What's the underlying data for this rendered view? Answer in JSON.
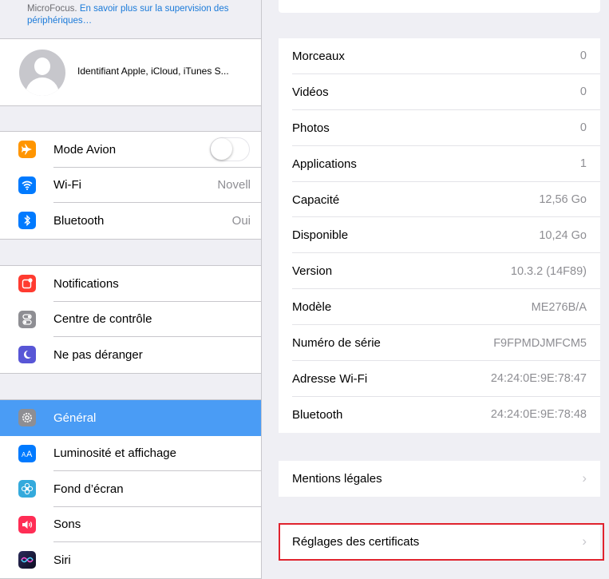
{
  "sidebar": {
    "supervision": {
      "org": "MicroFocus.",
      "link": "En savoir plus sur la supervision des périphériques…"
    },
    "profile": {
      "label": "Identifiant Apple, iCloud, iTunes S..."
    },
    "groups": [
      {
        "items": [
          {
            "label": "Mode Avion",
            "icon": "airplane-icon",
            "color": "#ff9500",
            "value": "",
            "toggle": true,
            "toggle_on": false
          },
          {
            "label": "Wi-Fi",
            "icon": "wifi-icon",
            "color": "#007aff",
            "value": "Novell"
          },
          {
            "label": "Bluetooth",
            "icon": "bluetooth-icon",
            "color": "#007aff",
            "value": "Oui"
          }
        ]
      },
      {
        "items": [
          {
            "label": "Notifications",
            "icon": "notifications-icon",
            "color": "#ff3b30"
          },
          {
            "label": "Centre de contrôle",
            "icon": "control-center-icon",
            "color": "#8e8e93"
          },
          {
            "label": "Ne pas déranger",
            "icon": "moon-icon",
            "color": "#5856d6"
          }
        ]
      },
      {
        "items": [
          {
            "label": "Général",
            "icon": "gear-icon",
            "color": "#8e8e93",
            "selected": true
          },
          {
            "label": "Luminosité et affichage",
            "icon": "display-icon",
            "color": "#007aff"
          },
          {
            "label": "Fond d’écran",
            "icon": "wallpaper-icon",
            "color": "#34aadc"
          },
          {
            "label": "Sons",
            "icon": "sounds-icon",
            "color": "#ff2d55"
          },
          {
            "label": "Siri",
            "icon": "siri-icon",
            "color": "#1c1c3c"
          }
        ]
      }
    ]
  },
  "main": {
    "info_rows": [
      {
        "label": "Morceaux",
        "value": "0"
      },
      {
        "label": "Vidéos",
        "value": "0"
      },
      {
        "label": "Photos",
        "value": "0"
      },
      {
        "label": "Applications",
        "value": "1"
      },
      {
        "label": "Capacité",
        "value": "12,56 Go"
      },
      {
        "label": "Disponible",
        "value": "10,24 Go"
      },
      {
        "label": "Version",
        "value": "10.3.2 (14F89)"
      },
      {
        "label": "Modèle",
        "value": "ME276B/A"
      },
      {
        "label": "Numéro de série",
        "value": "F9FPMDJMFCM5"
      },
      {
        "label": "Adresse Wi-Fi",
        "value": "24:24:0E:9E:78:47"
      },
      {
        "label": "Bluetooth",
        "value": "24:24:0E:9E:78:48"
      }
    ],
    "legal_label": "Mentions légales",
    "certificates_label": "Réglages des certificats"
  },
  "colors": {
    "selected_row": "#4a9cf5",
    "link": "#1a7ad9",
    "highlight_border": "#e0232e"
  }
}
